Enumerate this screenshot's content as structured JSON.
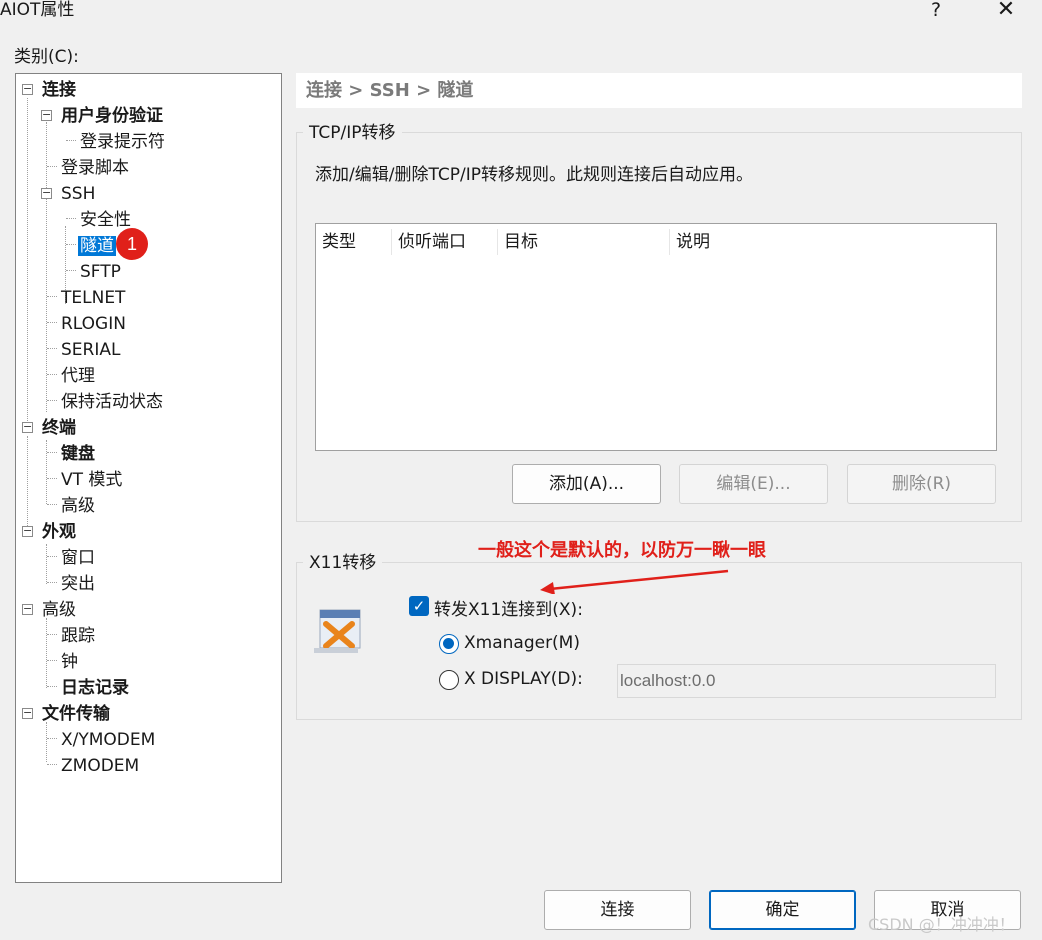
{
  "window": {
    "title": "AIOT属性",
    "help": "?",
    "close": "✕"
  },
  "category_label": "类别(C):",
  "tree": {
    "items": [
      {
        "label": "连接"
      },
      {
        "label": "用户身份验证"
      },
      {
        "label": "登录提示符"
      },
      {
        "label": "登录脚本"
      },
      {
        "label": "SSH"
      },
      {
        "label": "安全性"
      },
      {
        "label": "隧道"
      },
      {
        "label": "SFTP"
      },
      {
        "label": "TELNET"
      },
      {
        "label": "RLOGIN"
      },
      {
        "label": "SERIAL"
      },
      {
        "label": "代理"
      },
      {
        "label": "保持活动状态"
      },
      {
        "label": "终端"
      },
      {
        "label": "键盘"
      },
      {
        "label": "VT 模式"
      },
      {
        "label": "高级"
      },
      {
        "label": "外观"
      },
      {
        "label": "窗口"
      },
      {
        "label": "突出"
      },
      {
        "label": "高级"
      },
      {
        "label": "跟踪"
      },
      {
        "label": "钟"
      },
      {
        "label": "日志记录"
      },
      {
        "label": "文件传输"
      },
      {
        "label": "X/YMODEM"
      },
      {
        "label": "ZMODEM"
      }
    ],
    "badge": "1"
  },
  "breadcrumb": "连接 > SSH > 隧道",
  "tcp": {
    "title": "TCP/IP转移",
    "description": "添加/编辑/删除TCP/IP转移规则。此规则连接后自动应用。",
    "columns": [
      "类型",
      "侦听端口",
      "目标",
      "说明"
    ],
    "add": "添加(A)...",
    "edit": "编辑(E)...",
    "delete": "删除(R)"
  },
  "x11": {
    "title": "X11转移",
    "annotation": "一般这个是默认的，以防万一瞅一眼",
    "forward_label": "转发X11连接到(X):",
    "forward_checked": true,
    "xmanager_label": "Xmanager(M)",
    "xdisplay_label": "X DISPLAY(D):",
    "xdisplay_value": "localhost:0.0",
    "selected": "xmanager"
  },
  "footer": {
    "connect": "连接",
    "ok": "确定",
    "cancel": "取消"
  },
  "watermark": "CSDN @！冲冲冲！",
  "colors": {
    "accent": "#0067c0",
    "selection": "#0078d7",
    "annotation": "#e0201a"
  }
}
